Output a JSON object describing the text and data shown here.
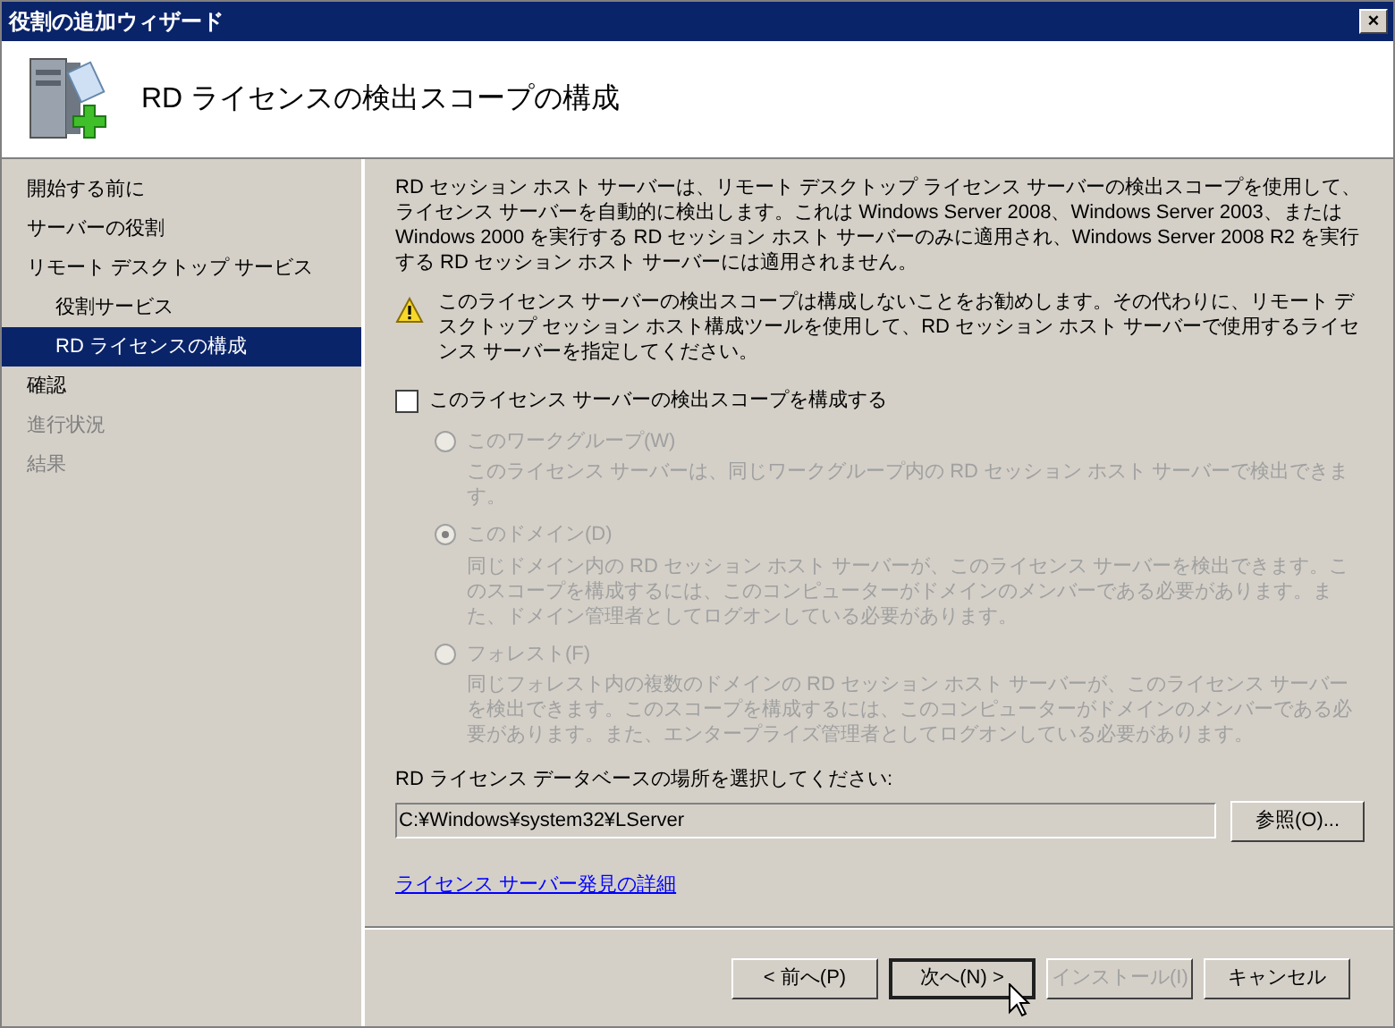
{
  "window": {
    "title": "役割の追加ウィザード",
    "close": "×"
  },
  "header": {
    "title": "RD ライセンスの検出スコープの構成"
  },
  "sidebar": {
    "items": [
      {
        "label": "開始する前に",
        "selected": false,
        "disabled": false
      },
      {
        "label": "サーバーの役割",
        "selected": false,
        "disabled": false
      },
      {
        "label": "リモート デスクトップ サービス",
        "selected": false,
        "disabled": false,
        "children": [
          {
            "label": "役割サービス",
            "selected": false,
            "disabled": false
          },
          {
            "label": "RD ライセンスの構成",
            "selected": true,
            "disabled": false
          }
        ]
      },
      {
        "label": "確認",
        "selected": false,
        "disabled": false
      },
      {
        "label": "進行状況",
        "selected": false,
        "disabled": true
      },
      {
        "label": "結果",
        "selected": false,
        "disabled": true
      }
    ]
  },
  "intro": "RD セッション ホスト サーバーは、リモート デスクトップ ライセンス サーバーの検出スコープを使用して、ライセンス サーバーを自動的に検出します。これは Windows Server 2008、Windows Server 2003、または Windows 2000 を実行する RD セッション ホスト サーバーのみに適用され、Windows Server 2008 R2 を実行する RD セッション ホスト サーバーには適用されません。",
  "warning": "このライセンス サーバーの検出スコープは構成しないことをお勧めします。その代わりに、リモート デスクトップ セッション ホスト構成ツールを使用して、RD セッション ホスト サーバーで使用するライセンス サーバーを指定してください。",
  "configure_checkbox": {
    "label": "このライセンス サーバーの検出スコープを構成する",
    "checked": false
  },
  "scopes": [
    {
      "label": "このワークグループ(W)",
      "description": "このライセンス サーバーは、同じワークグループ内の RD セッション ホスト サーバーで検出できます。",
      "selected": false,
      "disabled": true
    },
    {
      "label": "このドメイン(D)",
      "description": "同じドメイン内の RD セッション ホスト サーバーが、このライセンス サーバーを検出できます。このスコープを構成するには、このコンピューターがドメインのメンバーである必要があります。また、ドメイン管理者としてログオンしている必要があります。",
      "selected": true,
      "disabled": true
    },
    {
      "label": "フォレスト(F)",
      "description": "同じフォレスト内の複数のドメインの RD セッション ホスト サーバーが、このライセンス サーバーを検出できます。このスコープを構成するには、このコンピューターがドメインのメンバーである必要があります。また、エンタープライズ管理者としてログオンしている必要があります。",
      "selected": false,
      "disabled": true
    }
  ],
  "database": {
    "label": "RD ライセンス データベースの場所を選択してください:",
    "value": "C:¥Windows¥system32¥LServer",
    "browse": "参照(O)..."
  },
  "link": "ライセンス サーバー発見の詳細",
  "buttons": [
    {
      "label": "< 前へ(P)",
      "disabled": false,
      "default": false
    },
    {
      "label": "次へ(N) >",
      "disabled": false,
      "default": true
    },
    {
      "label": "インストール(I)",
      "disabled": true,
      "default": false
    },
    {
      "label": "キャンセル",
      "disabled": false,
      "default": false
    }
  ]
}
